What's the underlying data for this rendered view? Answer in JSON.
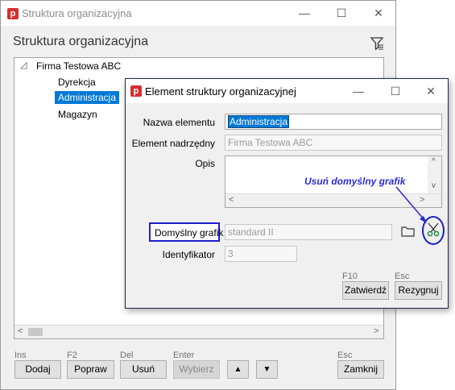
{
  "main_window": {
    "title": "Struktura organizacyjna",
    "heading": "Struktura organizacyjna",
    "caption_buttons": {
      "minimize": "—",
      "maximize": "☐",
      "close": "✕"
    },
    "tree": {
      "root": {
        "toggle": "◿",
        "label": "Firma Testowa ABC"
      },
      "children": [
        "Dyrekcja",
        "Administracja",
        "Magazyn"
      ],
      "selected_index": 1
    },
    "scroll": {
      "left": "<",
      "right": ">"
    },
    "buttons": [
      {
        "hotkey": "Ins",
        "label": "Dodaj",
        "enabled": true
      },
      {
        "hotkey": "F2",
        "label": "Popraw",
        "enabled": true
      },
      {
        "hotkey": "Del",
        "label": "Usuń",
        "enabled": true
      },
      {
        "hotkey": "Enter",
        "label": "Wybierz",
        "enabled": false
      }
    ],
    "arrow_up": "▲",
    "arrow_down": "▼",
    "close_button": {
      "hotkey": "Esc",
      "label": "Zamknij"
    }
  },
  "dialog": {
    "title": "Element struktury organizacyjnej",
    "caption_buttons": {
      "minimize": "—",
      "maximize": "☐",
      "close": "✕"
    },
    "fields": {
      "nazwa_label": "Nazwa elementu",
      "nazwa_value": "Administracja",
      "nadrzedny_label": "Element nadrzędny",
      "nadrzedny_value": "Firma Testowa ABC",
      "opis_label": "Opis",
      "opis_value": "",
      "grafik_label": "Domyślny grafik",
      "grafik_value": "standard II",
      "identyfikator_label": "Identyfikator",
      "identyfikator_value": "3"
    },
    "scroll": {
      "left": "<",
      "right": ">",
      "up": "^",
      "down": "v"
    },
    "annotation": "Usuń domyślny grafik",
    "buttons": {
      "ok_hotkey": "F10",
      "ok_label": "Zatwierdź",
      "cancel_hotkey": "Esc",
      "cancel_label": "Rezygnuj"
    }
  },
  "colors": {
    "selection": "#0078d7",
    "annotation": "#2b2bd6",
    "app_icon": "#d32f2f",
    "dialog_border": "#1e2a48"
  }
}
